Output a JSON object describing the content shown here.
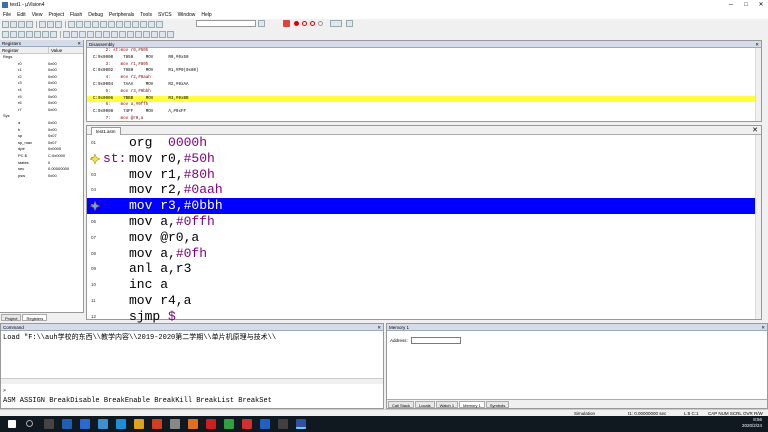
{
  "window": {
    "title": "test1 - µVision4",
    "minimize": "─",
    "maximize": "□",
    "close": "✕"
  },
  "menu": [
    "File",
    "Edit",
    "View",
    "Project",
    "Flash",
    "Debug",
    "Peripherals",
    "Tools",
    "SVCS",
    "Window",
    "Help"
  ],
  "registers": {
    "title": "Registers",
    "headers": [
      "Register",
      "Value"
    ],
    "rows": [
      {
        "name": "Regs",
        "value": ""
      },
      {
        "name": "r0",
        "value": "0x00"
      },
      {
        "name": "r1",
        "value": "0x00"
      },
      {
        "name": "r2",
        "value": "0x00"
      },
      {
        "name": "r3",
        "value": "0x00"
      },
      {
        "name": "r4",
        "value": "0x00"
      },
      {
        "name": "r5",
        "value": "0x00"
      },
      {
        "name": "r6",
        "value": "0x00"
      },
      {
        "name": "r7",
        "value": "0x00"
      },
      {
        "name": "Sys",
        "value": ""
      },
      {
        "name": "a",
        "value": "0x00"
      },
      {
        "name": "b",
        "value": "0x00"
      },
      {
        "name": "sp",
        "value": "0x07"
      },
      {
        "name": "sp_max",
        "value": "0x07"
      },
      {
        "name": "dptr",
        "value": "0x0000"
      },
      {
        "name": "PC $",
        "value": "C:0x0000"
      },
      {
        "name": "states",
        "value": "0"
      },
      {
        "name": "sec",
        "value": "0.00000000"
      },
      {
        "name": "psw",
        "value": "0x00"
      }
    ],
    "tabs": [
      "Project",
      "Registers"
    ]
  },
  "disassembly": {
    "title": "Disassembly",
    "lines": [
      {
        "text": "     2: st:mov r0,#50h",
        "kind": "src"
      },
      {
        "text": "C:0x0000    7850     MOV      R0,#0x50",
        "kind": "asm"
      },
      {
        "text": "     3:    mov r1,#80h",
        "kind": "src"
      },
      {
        "text": "C:0x0002    7980     MOV      R1,#P0(0x80)",
        "kind": "asm"
      },
      {
        "text": "     4:    mov r2,#0aah",
        "kind": "src"
      },
      {
        "text": "C:0x0004    7AAA     MOV      R2,#0xAA",
        "kind": "asm"
      },
      {
        "text": "     5:    mov r3,#0bbh",
        "kind": "src"
      },
      {
        "text": "C:0x0006    7BBB     MOV      R3,#0xBB",
        "kind": "hl"
      },
      {
        "text": "     6:    mov a,#0ffh",
        "kind": "src"
      },
      {
        "text": "C:0x0008    74FF     MOV      A,#0xFF",
        "kind": "asm"
      },
      {
        "text": "     7:    mov @r0,a",
        "kind": "src"
      }
    ]
  },
  "editor": {
    "tab": "test1.asm",
    "lines": [
      {
        "no": "01",
        "label": "",
        "code": "org  ",
        "num": "0000h"
      },
      {
        "no": "02",
        "label": "st:",
        "code": "mov r0,",
        "num": "#50h"
      },
      {
        "no": "03",
        "label": "",
        "code": "mov r1,",
        "num": "#80h"
      },
      {
        "no": "04",
        "label": "",
        "code": "mov r2,",
        "num": "#0aah"
      },
      {
        "no": "05",
        "label": "",
        "code": "mov r3,",
        "num": "#0bbh"
      },
      {
        "no": "06",
        "label": "",
        "code": "mov a,",
        "num": "#0ffh"
      },
      {
        "no": "07",
        "label": "",
        "code": "mov @r0,a",
        "num": ""
      },
      {
        "no": "08",
        "label": "",
        "code": "mov a,",
        "num": "#0fh"
      },
      {
        "no": "09",
        "label": "",
        "code": "anl a,r3",
        "num": ""
      },
      {
        "no": "10",
        "label": "",
        "code": "inc a",
        "num": ""
      },
      {
        "no": "11",
        "label": "",
        "code": "mov r4,a",
        "num": ""
      },
      {
        "no": "12",
        "label": "",
        "code": "sjmp ",
        "num": "$"
      }
    ]
  },
  "command": {
    "title": "Command",
    "output": "Load \"F:\\\\auh学校的东西\\\\教学内容\\\\2019-2020第二学期\\\\单片机原理与技术\\\\",
    "prompt": ">",
    "help": "ASM ASSIGN BreakDisable BreakEnable BreakKill BreakList BreakSet"
  },
  "memory": {
    "title": "Memory 1",
    "address_label": "Address:",
    "address_value": "",
    "tabs": [
      "Call Stack",
      "Locals",
      "Watch 1",
      "Memory 1",
      "Symbols"
    ]
  },
  "status": {
    "mode": "Simulation",
    "time": "t1: 0.00000000 sec",
    "pos": "L:5 C:1",
    "flags": "CAP  NUM  SCRL  OVR  R/W"
  },
  "clock": {
    "time": "8:56",
    "date": "2020/2/24"
  }
}
